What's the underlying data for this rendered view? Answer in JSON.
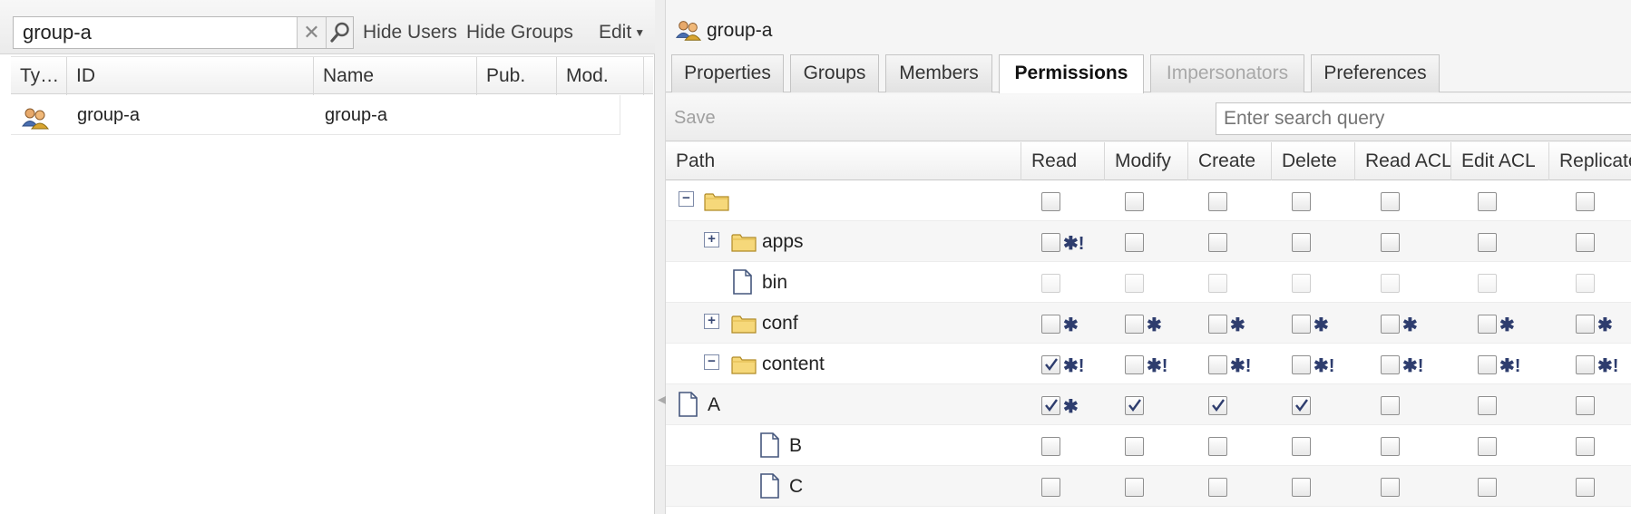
{
  "left": {
    "search": {
      "value": "group-a"
    },
    "toolbar": {
      "hide_users": "Hide Users",
      "hide_groups": "Hide Groups",
      "edit": "Edit"
    },
    "columns": [
      "Ty…",
      "ID",
      "Name",
      "Pub.",
      "Mod."
    ],
    "rows": [
      {
        "type_icon": "group-icon",
        "id": "group-a",
        "name": "group-a",
        "pub": "",
        "mod": ""
      }
    ]
  },
  "right": {
    "title": "group-a",
    "tabs": [
      "Properties",
      "Groups",
      "Members",
      "Permissions",
      "Impersonators",
      "Preferences"
    ],
    "active_tab": "Permissions",
    "disabled_tab": "Impersonators",
    "save_label": "Save",
    "search_placeholder": "Enter search query",
    "perm_columns": [
      "Path",
      "Read",
      "Modify",
      "Create",
      "Delete",
      "Read ACL",
      "Edit ACL",
      "Replicate"
    ],
    "perm_rows": [
      {
        "name": "",
        "icon": "folder-icon",
        "toggle": "collapse",
        "depth": 0,
        "checks": [
          false,
          false,
          false,
          false,
          false,
          false,
          false
        ],
        "marks": [
          "",
          "",
          "",
          "",
          "",
          "",
          ""
        ]
      },
      {
        "name": "apps",
        "icon": "folder-icon",
        "toggle": "expand",
        "depth": 1,
        "checks": [
          false,
          false,
          false,
          false,
          false,
          false,
          false
        ],
        "marks": [
          "✱!",
          "",
          "",
          "",
          "",
          "",
          ""
        ]
      },
      {
        "name": "bin",
        "icon": "file-icon",
        "toggle": "",
        "depth": 1,
        "dim": true,
        "checks": [
          false,
          false,
          false,
          false,
          false,
          false,
          false
        ],
        "marks": [
          "",
          "",
          "",
          "",
          "",
          "",
          ""
        ]
      },
      {
        "name": "conf",
        "icon": "folder-icon",
        "toggle": "expand",
        "depth": 1,
        "checks": [
          false,
          false,
          false,
          false,
          false,
          false,
          false
        ],
        "marks": [
          "✱",
          "✱",
          "✱",
          "✱",
          "✱",
          "✱",
          "✱"
        ]
      },
      {
        "name": "content",
        "icon": "folder-icon",
        "toggle": "collapse",
        "depth": 1,
        "checks": [
          true,
          false,
          false,
          false,
          false,
          false,
          false
        ],
        "marks": [
          "✱!",
          "✱!",
          "✱!",
          "✱!",
          "✱!",
          "✱!",
          "✱!"
        ]
      },
      {
        "name": "A",
        "icon": "file-icon",
        "toggle": "",
        "depth": 0,
        "checks": [
          true,
          true,
          true,
          true,
          false,
          false,
          false
        ],
        "marks": [
          "✱",
          "",
          "",
          "",
          "",
          "",
          ""
        ]
      },
      {
        "name": "B",
        "icon": "file-icon",
        "toggle": "",
        "depth": 2,
        "checks": [
          false,
          false,
          false,
          false,
          false,
          false,
          false
        ],
        "marks": [
          "",
          "",
          "",
          "",
          "",
          "",
          ""
        ]
      },
      {
        "name": "C",
        "icon": "file-icon",
        "toggle": "",
        "depth": 2,
        "checks": [
          false,
          false,
          false,
          false,
          false,
          false,
          false
        ],
        "marks": [
          "",
          "",
          "",
          "",
          "",
          "",
          ""
        ]
      }
    ]
  }
}
